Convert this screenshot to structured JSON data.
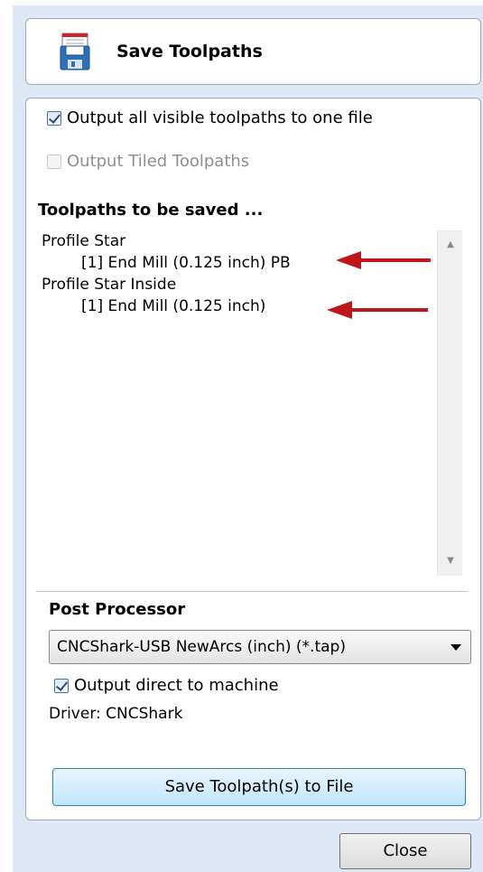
{
  "header": {
    "title": "Save Toolpaths",
    "icon": "save-floppy-icon"
  },
  "options": {
    "output_all": {
      "label": "Output all visible toolpaths to one file",
      "checked": true
    },
    "output_tiled": {
      "label": "Output Tiled Toolpaths",
      "checked": false,
      "disabled": true
    }
  },
  "toolpaths": {
    "heading": "Toolpaths to be saved ...",
    "items": [
      {
        "name": "Profile Star",
        "tool": "[1] End Mill (0.125 inch) PB"
      },
      {
        "name": "Profile Star Inside",
        "tool": "[1] End Mill (0.125 inch)"
      }
    ]
  },
  "post_processor": {
    "heading": "Post Processor",
    "selected": "CNCShark-USB NewArcs (inch) (*.tap)",
    "output_direct": {
      "label": "Output direct to machine",
      "checked": true
    },
    "driver": "Driver: CNCShark"
  },
  "buttons": {
    "save": "Save Toolpath(s) to File",
    "close": "Close"
  },
  "colors": {
    "arrow": "#c0161b",
    "panel_bg": "#dfe8f5",
    "button_accent": "#3c7fb1"
  }
}
